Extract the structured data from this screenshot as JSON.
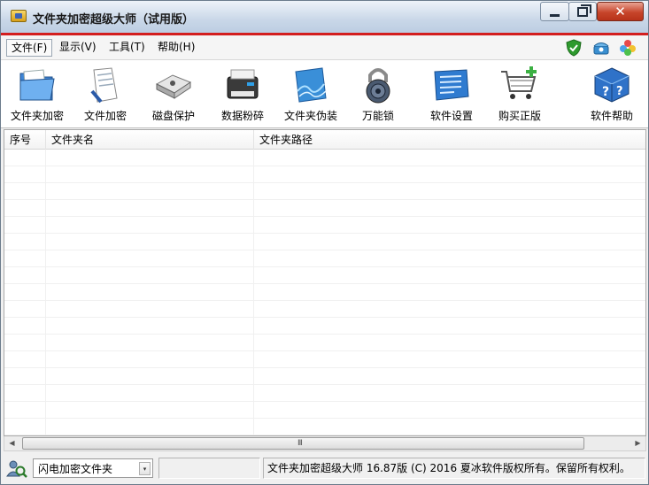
{
  "window": {
    "title": "文件夹加密超级大师（试用版）",
    "accent": "#d31e1e"
  },
  "menu": {
    "items": [
      {
        "label": "文件(F)"
      },
      {
        "label": "显示(V)"
      },
      {
        "label": "工具(T)"
      },
      {
        "label": "帮助(H)"
      }
    ],
    "right_icons": [
      "shield-check-icon",
      "telephone-icon",
      "clover-icon"
    ]
  },
  "toolbar": {
    "items": [
      {
        "label": "文件夹加密",
        "icon": "folder-lock-icon"
      },
      {
        "label": "文件加密",
        "icon": "document-lock-icon"
      },
      {
        "label": "磁盘保护",
        "icon": "disk-drive-icon"
      },
      {
        "label": "数据粉碎",
        "icon": "shredder-icon"
      },
      {
        "label": "文件夹伪装",
        "icon": "folder-disguise-icon"
      },
      {
        "label": "万能锁",
        "icon": "padlock-icon"
      },
      {
        "label": "软件设置",
        "icon": "settings-panel-icon"
      },
      {
        "label": "购买正版",
        "icon": "shopping-cart-icon"
      },
      {
        "label": "软件帮助",
        "icon": "help-cube-icon"
      }
    ]
  },
  "table": {
    "columns": [
      "序号",
      "文件夹名",
      "文件夹路径"
    ],
    "rows": []
  },
  "statusbar": {
    "mode_value": "闪电加密文件夹",
    "info_text": "",
    "message": "文件夹加密超级大师 16.87版 (C) 2016  夏冰软件版权所有。保留所有权利。"
  }
}
